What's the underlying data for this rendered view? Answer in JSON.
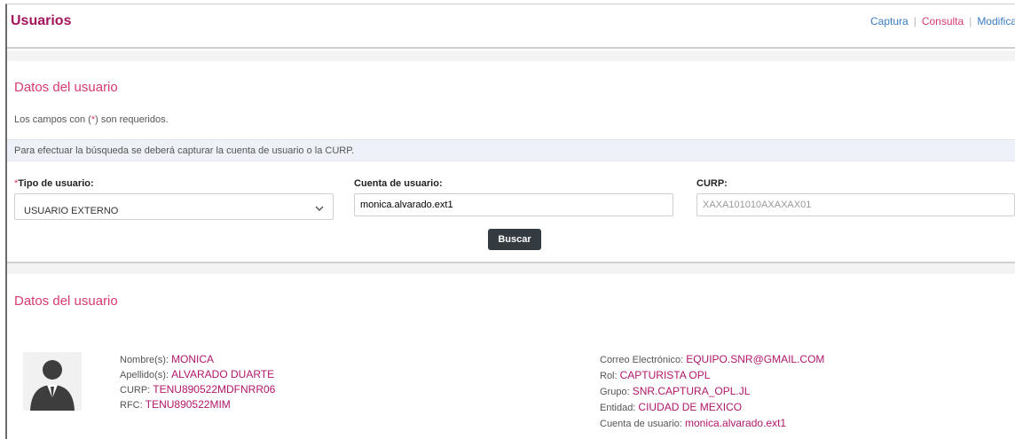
{
  "header": {
    "title": "Usuarios",
    "links": [
      {
        "label": "Captura"
      },
      {
        "label": "Consulta"
      },
      {
        "label": "Modifica"
      }
    ],
    "link_separator": "|"
  },
  "search": {
    "section_title": "Datos del usuario",
    "required_note_pre": "Los campos con (",
    "required_note_ast": "*",
    "required_note_post": ") son requeridos.",
    "info_text": "Para efectuar la búsqueda se deberá capturar la cuenta de usuario o la CURP.",
    "tipo_label": "Tipo de usuario:",
    "tipo_required": "*",
    "tipo_value": "USUARIO EXTERNO",
    "cuenta_label": "Cuenta de usuario:",
    "cuenta_value": "monica.alvarado.ext1",
    "curp_label": "CURP:",
    "curp_placeholder": "XAXA101010AXAXAX01",
    "buscar_label": "Buscar"
  },
  "result": {
    "section_title": "Datos del usuario",
    "left": [
      {
        "label": "Nombre(s): ",
        "value": "MONICA"
      },
      {
        "label": "Apellido(s): ",
        "value": "ALVARADO DUARTE"
      },
      {
        "label": "CURP: ",
        "value": "TENU890522MDFNRR06"
      },
      {
        "label": "RFC: ",
        "value": "TENU890522MIM"
      }
    ],
    "right": [
      {
        "label": "Correo Electrónico: ",
        "value": "EQUIPO.SNR@GMAIL.COM"
      },
      {
        "label": "Rol: ",
        "value": "CAPTURISTA OPL"
      },
      {
        "label": "Grupo: ",
        "value": "SNR.CAPTURA_OPL.JL"
      },
      {
        "label": "Entidad: ",
        "value": "CIUDAD DE MEXICO"
      },
      {
        "label": "Cuenta de usuario: ",
        "value": "monica.alvarado.ext1"
      }
    ]
  },
  "colors": {
    "brand": "#a3145c",
    "accent": "#d63b6e",
    "link": "#3b7bbf",
    "button": "#333a40"
  },
  "icons": [
    "chevron-down-icon",
    "user-avatar-icon"
  ]
}
